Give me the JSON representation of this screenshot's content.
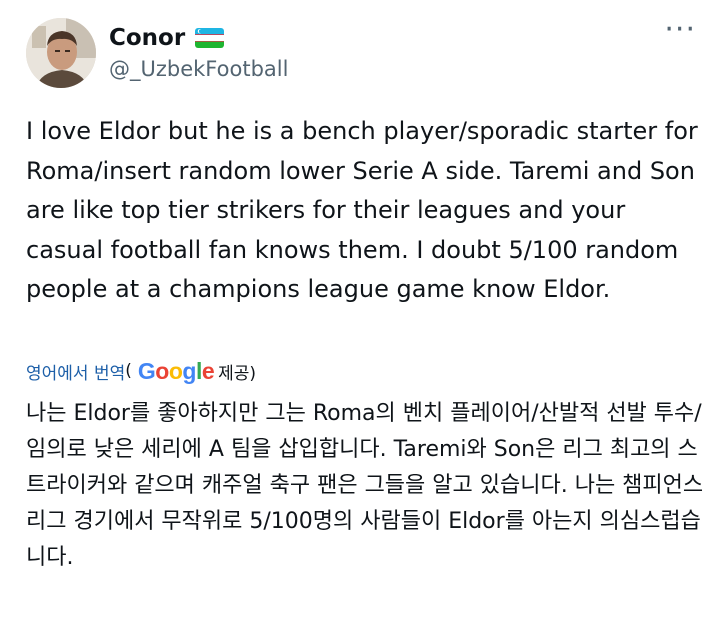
{
  "tweet": {
    "author": {
      "display_name": "Conor",
      "handle": "@_UzbekFootball",
      "flag_icon": "uzbekistan-flag-icon",
      "avatar_icon": "avatar-photo"
    },
    "more_icon": "more-horizontal-icon",
    "more_label": "···",
    "text": "I love Eldor but he is a bench player/sporadic starter for Roma/insert random lower Serie A side. Taremi and Son are like top tier strikers for their leagues and your casual football fan knows them. I doubt 5/100 random people at a champions league game know Eldor.",
    "translation": {
      "translated_from_label": "영어에서 번역",
      "open_paren": "(",
      "provider": "Google",
      "provided_label": " 제공)",
      "text": "나는 Eldor를 좋아하지만 그는 Roma의 벤치 플레이어/산발적 선발 투수/임의로 낮은 세리에 A 팀을 삽입합니다. Taremi와 Son은 리그 최고의 스트라이커와 같으며 캐주얼 축구 팬은 그들을 알고 있습니다. 나는 챔피언스 리그 경기에서 무작위로 5/100명의 사람들이 Eldor를 아는지 의심스럽습니다."
    }
  },
  "colors": {
    "text": "#0f1419",
    "secondary": "#536471",
    "link": "#1d5fa8",
    "background": "#ffffff"
  }
}
